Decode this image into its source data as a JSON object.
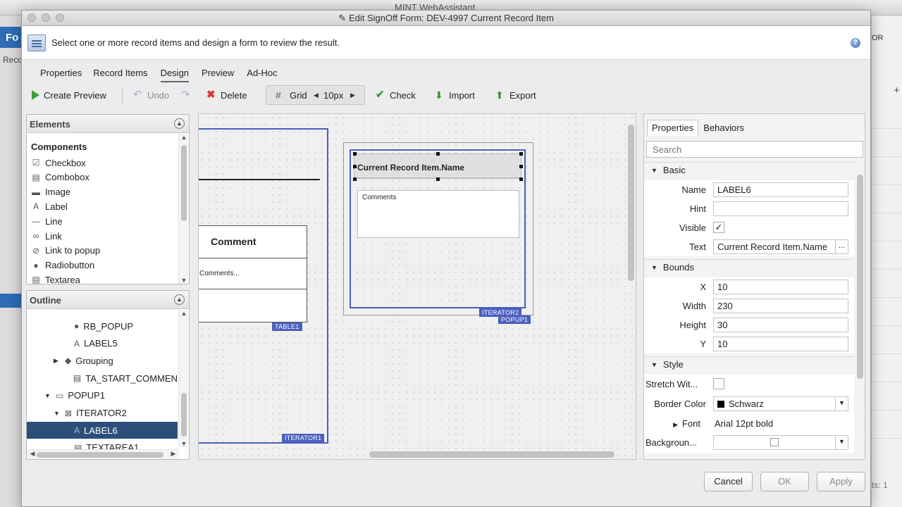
{
  "background_app": {
    "title": "MINT WebAssistant",
    "left_tab": "Fo",
    "left_text": "Reco",
    "right_text": "OR",
    "status_text": "ts: 1"
  },
  "dialog": {
    "title": "Edit SignOff Form: DEV-4997 Current Record Item",
    "instruction": "Select one or more record items and design a form to review the result.",
    "help_label": "?",
    "tabs": [
      {
        "label": "Properties",
        "active": false
      },
      {
        "label": "Record Items",
        "active": false
      },
      {
        "label": "Design",
        "active": true
      },
      {
        "label": "Preview",
        "active": false
      },
      {
        "label": "Ad-Hoc",
        "active": false
      }
    ],
    "toolbar": {
      "create_preview": "Create Preview",
      "undo": "Undo",
      "delete": "Delete",
      "grid": "Grid",
      "grid_size": "10px",
      "check": "Check",
      "import": "Import",
      "export": "Export"
    },
    "elements_panel": {
      "title": "Elements",
      "section": "Components",
      "items": [
        {
          "label": "Checkbox",
          "icon": "checkbox-icon",
          "glyph": "☑"
        },
        {
          "label": "Combobox",
          "icon": "combobox-icon",
          "glyph": "▤"
        },
        {
          "label": "Image",
          "icon": "image-icon",
          "glyph": "▬"
        },
        {
          "label": "Label",
          "icon": "label-icon",
          "glyph": "A"
        },
        {
          "label": "Line",
          "icon": "line-icon",
          "glyph": "—"
        },
        {
          "label": "Link",
          "icon": "link-icon",
          "glyph": "∞"
        },
        {
          "label": "Link to popup",
          "icon": "link-popup-icon",
          "glyph": "⊘"
        },
        {
          "label": "Radiobutton",
          "icon": "radio-icon",
          "glyph": "●"
        },
        {
          "label": "Textarea",
          "icon": "textarea-icon",
          "glyph": "▤"
        }
      ]
    },
    "outline_panel": {
      "title": "Outline",
      "items": [
        {
          "label": "RB_POPUP",
          "icon": "radio-icon",
          "glyph": "●",
          "indent": 3,
          "toggle": "",
          "selected": false
        },
        {
          "label": "LABEL5",
          "icon": "label-icon",
          "glyph": "A",
          "indent": 3,
          "toggle": "",
          "selected": false
        },
        {
          "label": "Grouping",
          "icon": "grouping-icon",
          "glyph": "◆",
          "indent": 2,
          "toggle": "▶",
          "selected": false
        },
        {
          "label": "TA_START_COMMEN",
          "icon": "textarea-icon",
          "glyph": "▤",
          "indent": 3,
          "toggle": "",
          "selected": false
        },
        {
          "label": "POPUP1",
          "icon": "popup-icon",
          "glyph": "▭",
          "indent": 1,
          "toggle": "▼",
          "selected": false
        },
        {
          "label": "ITERATOR2",
          "icon": "iterator-icon",
          "glyph": "⊠",
          "indent": 2,
          "toggle": "▼",
          "selected": false
        },
        {
          "label": "LABEL6",
          "icon": "label-icon",
          "glyph": "A",
          "indent": 3,
          "toggle": "",
          "selected": true
        },
        {
          "label": "TEXTAREA1",
          "icon": "textarea-icon",
          "glyph": "▤",
          "indent": 3,
          "toggle": "",
          "selected": false
        }
      ]
    },
    "canvas": {
      "iterator1_tag": "ITERATOR1",
      "table1_tag": "TABLE1",
      "table_header": "Comment",
      "table_cell": "Comments...",
      "iterator2_tag": "ITERATOR2",
      "popup1_tag": "POPUP1",
      "label6_text": "Current Record Item.Name",
      "textarea1_text": "Comments"
    },
    "properties": {
      "tabs": [
        {
          "label": "Properties",
          "active": true
        },
        {
          "label": "Behaviors",
          "active": false
        }
      ],
      "search_placeholder": "Search",
      "basic": {
        "title": "Basic",
        "name_label": "Name",
        "name_value": "LABEL6",
        "hint_label": "Hint",
        "hint_value": "",
        "visible_label": "Visible",
        "visible_checked": "✓",
        "text_label": "Text",
        "text_value": "Current Record Item.Name",
        "ellipsis": "..."
      },
      "bounds": {
        "title": "Bounds",
        "x_label": "X",
        "x_value": "10",
        "width_label": "Width",
        "width_value": "230",
        "height_label": "Height",
        "height_value": "30",
        "y_label": "Y",
        "y_value": "10"
      },
      "style": {
        "title": "Style",
        "stretch_label": "Stretch Wit...",
        "border_color_label": "Border Color",
        "border_color_value": "Schwarz",
        "font_label": "Font",
        "font_value": "Arial 12pt bold",
        "background_label": "Backgroun..."
      }
    },
    "footer": {
      "cancel": "Cancel",
      "ok": "OK",
      "apply": "Apply"
    },
    "colors": {
      "selection": "#2c4f7a",
      "container_border": "#4a5fbf",
      "accent_green": "#3a9d3a",
      "delete_red": "#dd3333"
    }
  }
}
